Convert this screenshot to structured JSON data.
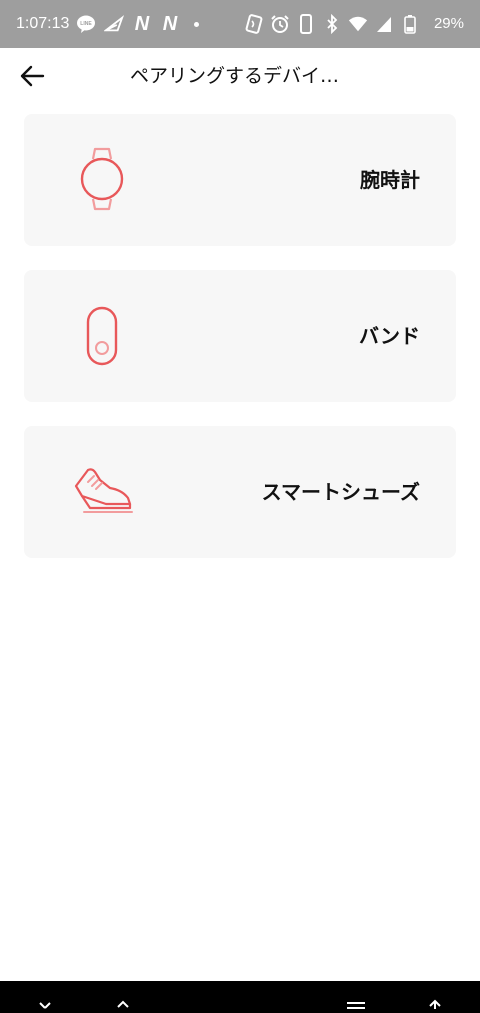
{
  "status_bar": {
    "time": "1:07:13",
    "battery": "29%",
    "left_icons": [
      "line-icon",
      "navigation-icon",
      "n-icon",
      "n-icon",
      "dot-icon"
    ],
    "right_icons": [
      "nfc-icon",
      "alarm-icon",
      "phone-icon",
      "bluetooth-icon",
      "wifi-icon",
      "signal-icon",
      "battery-icon"
    ],
    "n_glyph": "N"
  },
  "app_bar": {
    "back_icon": "back-arrow-icon",
    "title": "ペアリングするデバイ…"
  },
  "devices": [
    {
      "label": "腕時計",
      "icon": "watch-icon"
    },
    {
      "label": "バンド",
      "icon": "band-icon"
    },
    {
      "label": "スマートシューズ",
      "icon": "shoe-icon"
    }
  ],
  "nav_bar": {
    "buttons": [
      "close-icon",
      "chevron-up-icon",
      "menu-icon",
      "arrow-up-icon"
    ]
  },
  "colors": {
    "accent": "#e8585a",
    "card_background": "#f7f7f7",
    "status_bar": "#9e9e9e",
    "nav_bar": "#000000"
  }
}
